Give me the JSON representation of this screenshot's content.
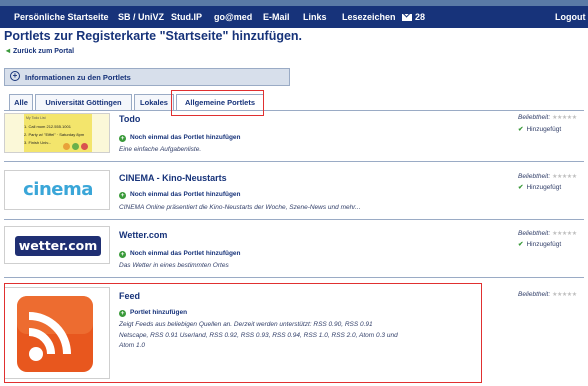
{
  "nav": {
    "items": [
      "Persönliche Startseite",
      "SB / UniVZ",
      "Stud.IP",
      "go@med",
      "E-Mail",
      "Links",
      "Lesezeichen"
    ],
    "mail_count": "28",
    "logout": "Logout"
  },
  "page": {
    "title": "Portlets zur Registerkarte \"Startseite\" hinzufügen.",
    "back": "Zurück zum Portal",
    "info": "Informationen zu den Portlets"
  },
  "tabs": [
    "Alle",
    "Universität Göttingen",
    "Lokales",
    "Allgemeine Portlets"
  ],
  "labels": {
    "popularity": "Beliebtheit:",
    "added": "Hinzugefügt",
    "add_again": "Noch einmal das Portlet hinzufügen",
    "add": "Portlet hinzufügen"
  },
  "portlets": [
    {
      "title": "Todo",
      "thumb": {
        "lines": [
          "Call mom 212.555.1001",
          "Party w/ \"Eiffel\" · Saturday 8pm",
          "Finish Univ..."
        ],
        "header": "My Todo List",
        "num": [
          "1.",
          "2.",
          "3."
        ]
      },
      "desc": [
        "Eine einfache Aufgabenliste."
      ]
    },
    {
      "title": "CINEMA - Kino-Neustarts",
      "thumb": {
        "logo": "cinema"
      },
      "desc": [
        "CINEMA Online präsentiert die Kino-Neustarts der Woche, Szene-News und mehr..."
      ]
    },
    {
      "title": "Wetter.com",
      "thumb": {
        "logo": "wetter.com"
      },
      "desc": [
        "Das Wetter in eines bestimmten Ortes"
      ]
    },
    {
      "title": "Feed",
      "desc": [
        "Zeigt Feeds aus beliebigen Quellen an. Derzeit werden unterstützt: RSS 0.90, RSS 0.91",
        "Netscape, RSS 0.91 Userland, RSS 0.92, RSS 0.93, RSS 0.94, RSS 1.0, RSS 2.0, Atom 0.3 und",
        "Atom 1.0"
      ]
    }
  ],
  "colors": {
    "nav_bg": "#17337a",
    "accent": "#17337a",
    "highlight": "#e03030",
    "rss": "#e8571e",
    "green": "#3a9a3a"
  }
}
